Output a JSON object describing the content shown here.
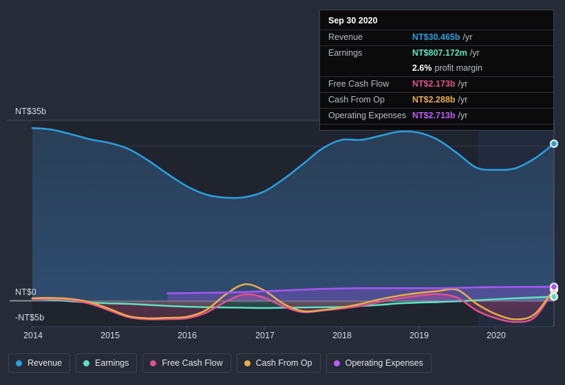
{
  "chart_data": {
    "type": "area",
    "title": "",
    "xlabel": "",
    "ylabel": "",
    "currency": "NT$",
    "grid": true,
    "legend_position": "bottom",
    "x": [
      2014.0,
      2014.25,
      2014.5,
      2014.75,
      2015.0,
      2015.25,
      2015.5,
      2015.75,
      2016.0,
      2016.25,
      2016.5,
      2016.75,
      2017.0,
      2017.25,
      2017.5,
      2017.75,
      2018.0,
      2018.25,
      2018.5,
      2018.75,
      2019.0,
      2019.25,
      2019.5,
      2019.75,
      2020.0,
      2020.25,
      2020.5,
      2020.75
    ],
    "x_ticks": [
      2014,
      2015,
      2016,
      2017,
      2018,
      2019,
      2020
    ],
    "y_ticks": [
      {
        "label": "NT$35b",
        "value": 35
      },
      {
        "label": "NT$0",
        "value": 0
      },
      {
        "label": "-NT$5b",
        "value": -5
      }
    ],
    "ylim": [
      -5,
      35
    ],
    "gridline_values": [
      35,
      30,
      20,
      10,
      0,
      -5
    ],
    "series": [
      {
        "name": "Revenue",
        "color": "#2a9fe0",
        "unit": "/yr",
        "filled": true,
        "values": [
          33.5,
          33.2,
          32.3,
          31.3,
          30.6,
          29.4,
          27.2,
          24.6,
          22.2,
          20.6,
          20.0,
          20.1,
          21.2,
          23.6,
          26.5,
          29.5,
          31.2,
          31.2,
          32.0,
          32.8,
          32.6,
          31.2,
          28.6,
          25.8,
          25.4,
          25.7,
          27.6,
          30.465
        ],
        "end_marker": true
      },
      {
        "name": "Earnings",
        "color": "#5fe0c0",
        "unit": "/yr",
        "filled": true,
        "values": [
          0.45,
          0.2,
          -0.1,
          -0.35,
          -0.5,
          -0.6,
          -0.8,
          -1.0,
          -1.15,
          -1.25,
          -1.3,
          -1.35,
          -1.4,
          -1.35,
          -1.3,
          -1.25,
          -1.2,
          -1.0,
          -0.8,
          -0.5,
          -0.35,
          -0.25,
          -0.1,
          0.1,
          0.3,
          0.5,
          0.65,
          0.807
        ],
        "end_marker": true
      },
      {
        "name": "Free Cash Flow",
        "color": "#e0518c",
        "unit": "/yr",
        "filled": true,
        "values": [
          0.4,
          0.35,
          0.1,
          -0.6,
          -1.9,
          -3.2,
          -3.6,
          -3.55,
          -3.4,
          -2.3,
          -0.2,
          1.25,
          0.6,
          -1.1,
          -2.2,
          -1.9,
          -1.5,
          -1.0,
          -0.2,
          0.5,
          1.0,
          1.3,
          0.6,
          -1.9,
          -3.4,
          -4.1,
          -3.2,
          2.173
        ],
        "end_marker": true
      },
      {
        "name": "Cash From Op",
        "color": "#e8ab4e",
        "unit": "/yr",
        "filled": false,
        "values": [
          0.5,
          0.55,
          0.35,
          -0.3,
          -1.6,
          -3.0,
          -3.4,
          -3.3,
          -3.1,
          -1.8,
          1.2,
          3.2,
          2.0,
          -0.6,
          -2.0,
          -1.8,
          -1.3,
          -0.6,
          0.3,
          1.0,
          1.5,
          1.9,
          2.1,
          -0.6,
          -2.6,
          -3.6,
          -2.6,
          2.288
        ],
        "end_marker": true
      },
      {
        "name": "Operating Expenses",
        "color": "#a855f7",
        "unit": "/yr",
        "filled": false,
        "start_index": 7,
        "values": [
          null,
          null,
          null,
          null,
          null,
          null,
          null,
          1.45,
          1.5,
          1.55,
          1.6,
          1.7,
          1.85,
          2.0,
          2.15,
          2.3,
          2.4,
          2.45,
          2.45,
          2.45,
          2.45,
          2.45,
          2.5,
          2.6,
          2.65,
          2.68,
          2.7,
          2.713
        ],
        "end_marker": true
      }
    ]
  },
  "tooltip": {
    "title": "Sep 30 2020",
    "rows": [
      {
        "key": "Revenue",
        "value": "NT$30.465b",
        "unit": "/yr",
        "color": "#2a9fe0"
      },
      {
        "key": "Earnings",
        "value": "NT$807.172m",
        "unit": "/yr",
        "color": "#5fe0c0"
      },
      {
        "key": "",
        "value": "2.6%",
        "unit": "profit margin",
        "color": "#ffffff",
        "no_rule": true
      },
      {
        "key": "Free Cash Flow",
        "value": "NT$2.173b",
        "unit": "/yr",
        "color": "#e0518c"
      },
      {
        "key": "Cash From Op",
        "value": "NT$2.288b",
        "unit": "/yr",
        "color": "#e8ab4e"
      },
      {
        "key": "Operating Expenses",
        "value": "NT$2.713b",
        "unit": "/yr",
        "color": "#bb5cf5"
      }
    ]
  },
  "legend": {
    "items": [
      {
        "label": "Revenue",
        "color": "#2a9fe0"
      },
      {
        "label": "Earnings",
        "color": "#5fe0c0"
      },
      {
        "label": "Free Cash Flow",
        "color": "#e0518c"
      },
      {
        "label": "Cash From Op",
        "color": "#e8ab4e"
      },
      {
        "label": "Operating Expenses",
        "color": "#bb5cf5"
      }
    ]
  },
  "colors": {
    "background": "#262b38",
    "plot_fill": "#2a4059",
    "forecast_band": "#1d3a5c",
    "gridline": "#394354",
    "zero_line": "#9aa3b0"
  }
}
